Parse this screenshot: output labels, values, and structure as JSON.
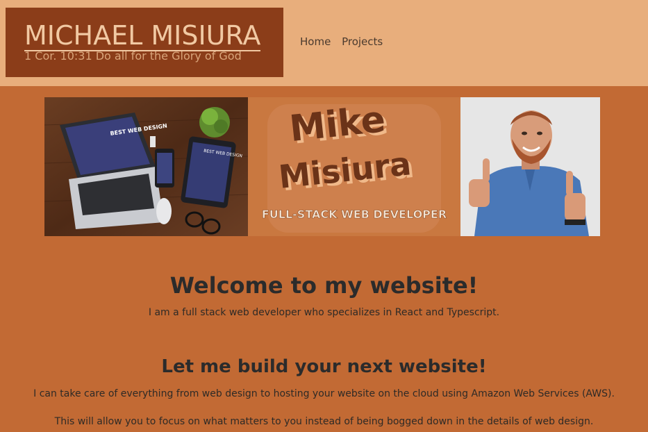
{
  "header": {
    "logo_name": "MICHAEL MISIURA",
    "logo_verse": "1 Cor. 10:31 Do all for the Glory of God",
    "nav": [
      {
        "label": "Home"
      },
      {
        "label": "Projects"
      }
    ]
  },
  "banner": {
    "laptop_text": "BEST WEB DESIGN",
    "tablet_text": "BEST WEB DESIGN",
    "title_line1": "Mike",
    "title_line2": "Misiura",
    "title_sub": "FULL-STACK WEB DEVELOPER"
  },
  "main": {
    "heading": "Welcome to my website!",
    "intro": "I am a full stack web developer who specializes in React and Typescript.",
    "subheading": "Let me build your next website!",
    "para1": "I can take care of everything from web design to hosting your website on the cloud using Amazon Web Services (AWS).",
    "para2": "This will allow you to focus on what matters to you instead of being bogged down in the details of web design."
  },
  "colors": {
    "page_bg": "#c26a34",
    "header_bg": "#e8ae7c",
    "logo_bg": "#8b3d19",
    "logo_text": "#f1c9a3",
    "title_brown": "#6b3318"
  }
}
